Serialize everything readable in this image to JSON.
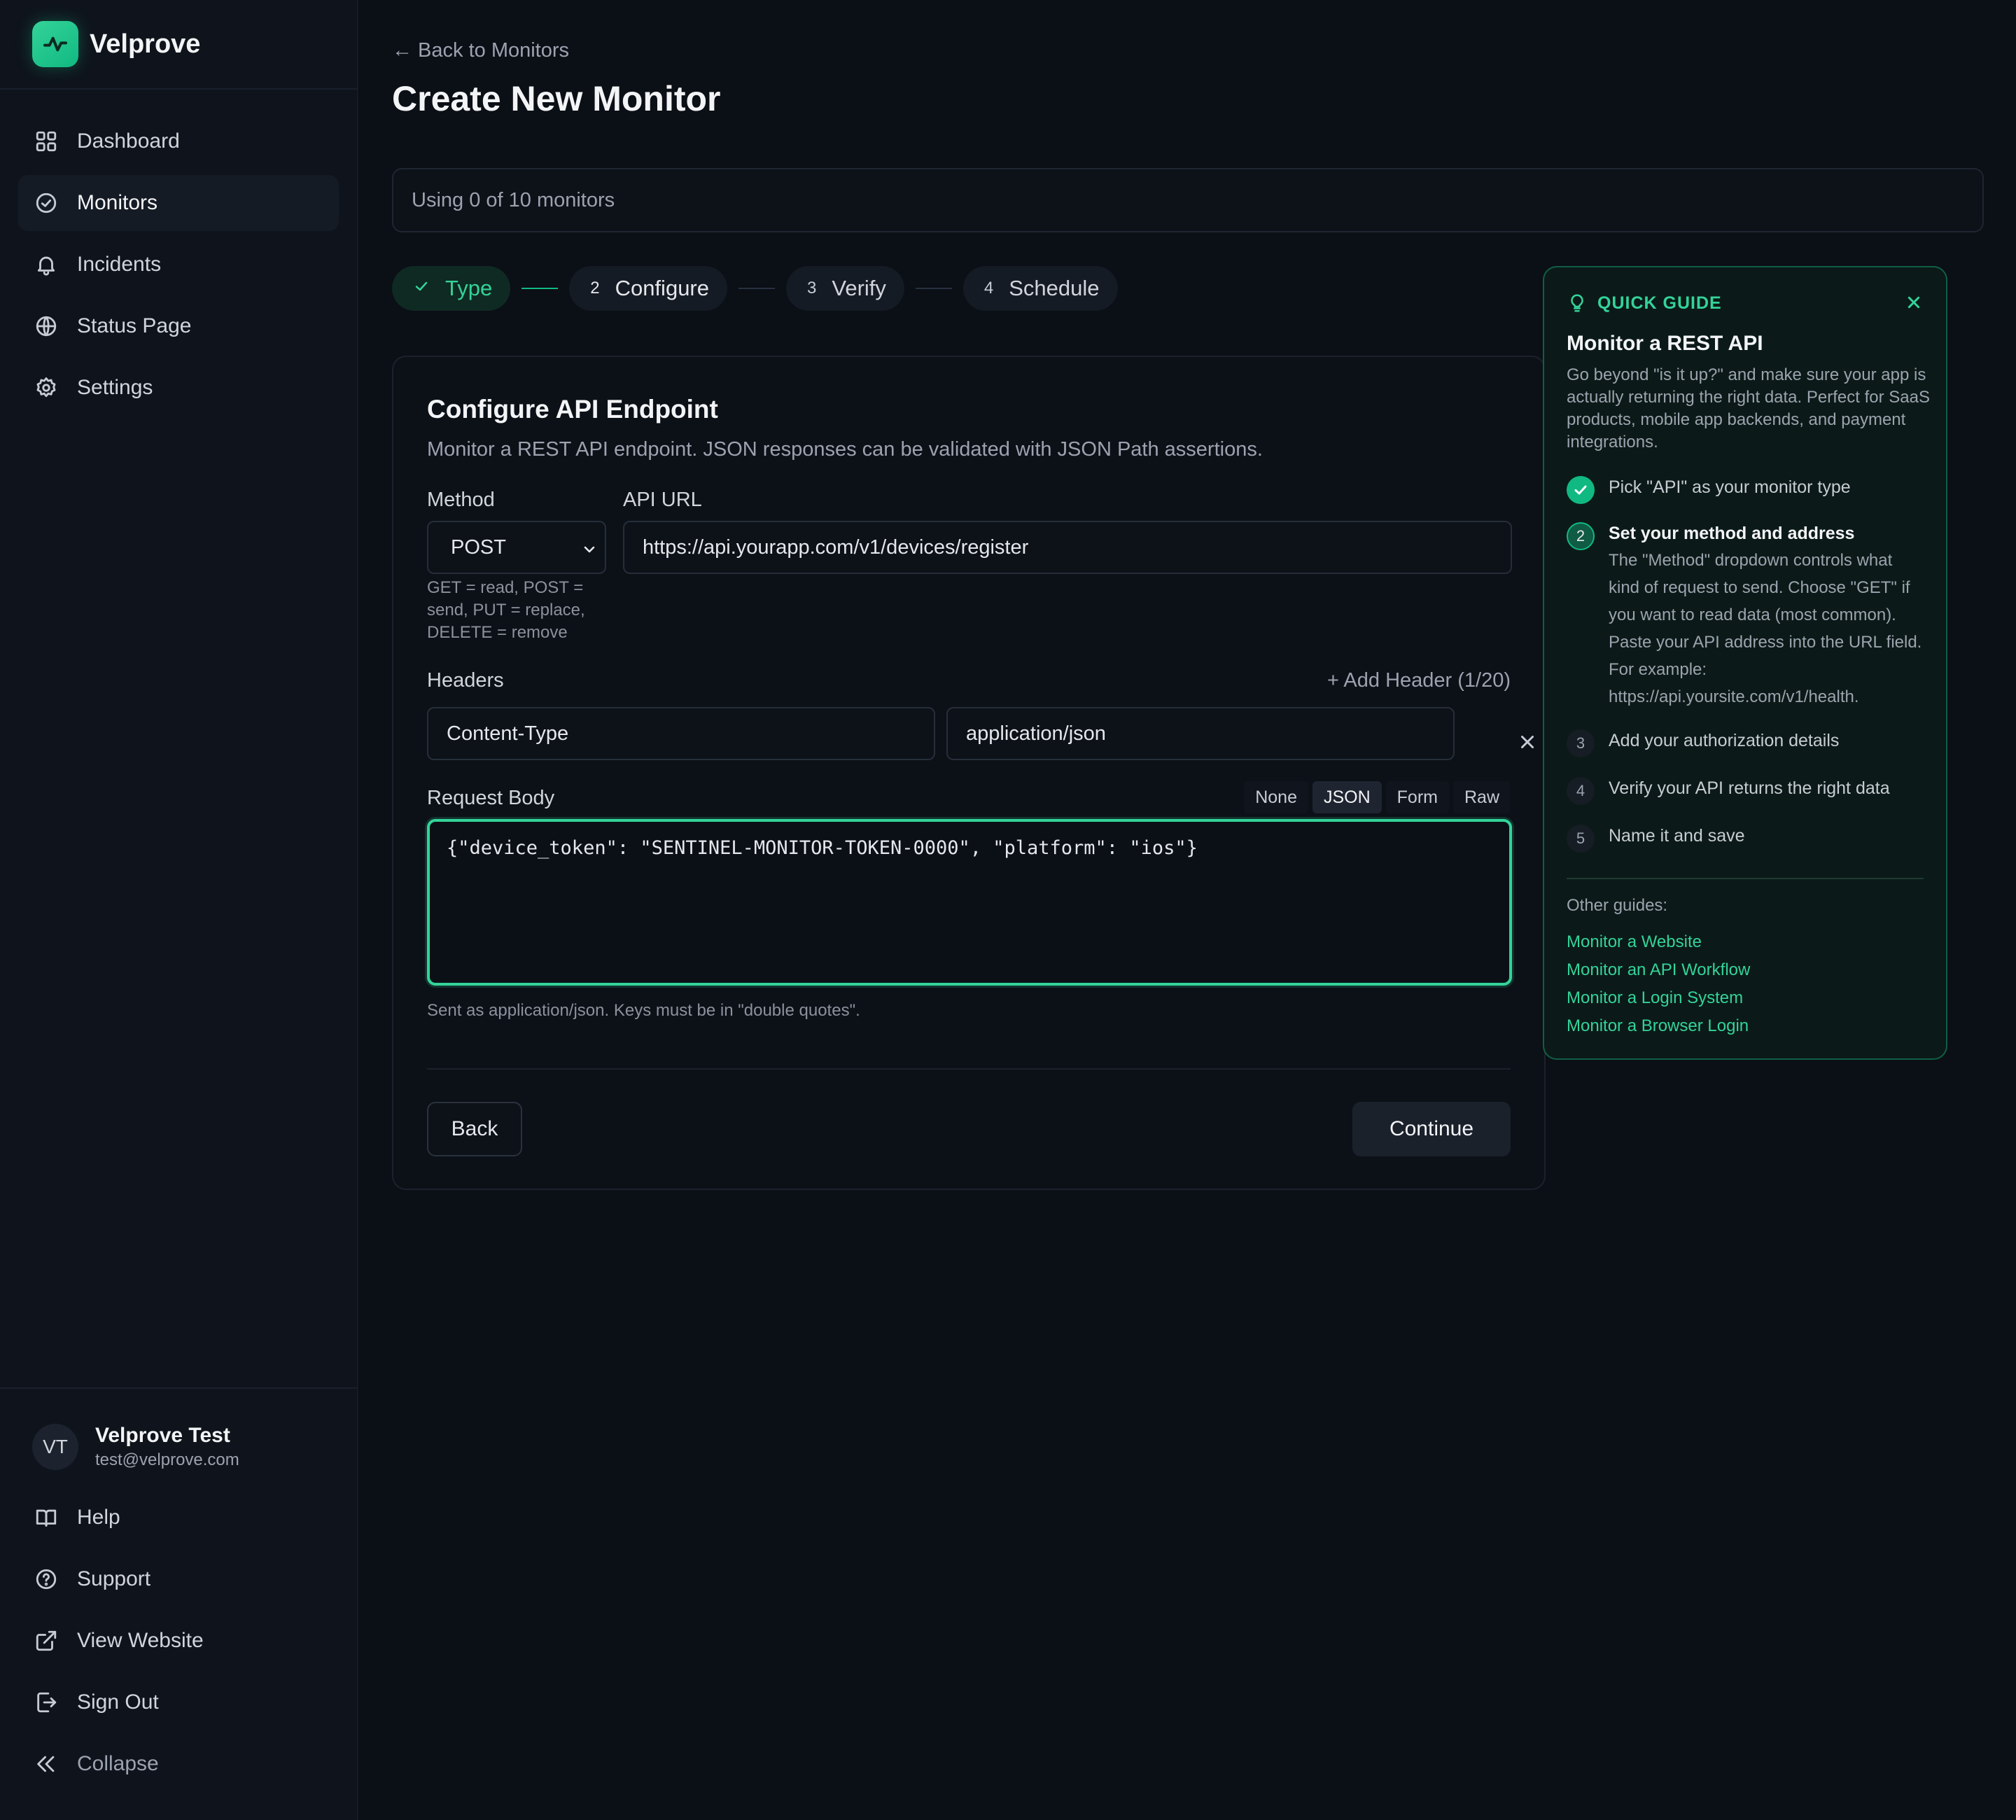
{
  "brand": {
    "name": "Velprove"
  },
  "nav": [
    {
      "label": "Dashboard",
      "icon": "grid-icon"
    },
    {
      "label": "Monitors",
      "icon": "check-circle-icon"
    },
    {
      "label": "Incidents",
      "icon": "bell-icon"
    },
    {
      "label": "Status Page",
      "icon": "globe-icon"
    },
    {
      "label": "Settings",
      "icon": "gear-icon"
    }
  ],
  "user": {
    "initials": "VT",
    "name": "Velprove Test",
    "email": "test@velprove.com"
  },
  "bottom_nav": [
    {
      "label": "Help",
      "icon": "book-icon"
    },
    {
      "label": "Support",
      "icon": "question-circle-icon"
    },
    {
      "label": "View Website",
      "icon": "external-link-icon"
    },
    {
      "label": "Sign Out",
      "icon": "sign-out-icon"
    },
    {
      "label": "Collapse",
      "icon": "double-chevron-left-icon"
    }
  ],
  "page": {
    "back_link": "← Back to Monitors",
    "title": "Create New Monitor",
    "usage": "Using 0 of 10 monitors"
  },
  "stepper": [
    {
      "num": "✓",
      "label": "Type",
      "state": "done"
    },
    {
      "num": "2",
      "label": "Configure",
      "state": "current"
    },
    {
      "num": "3",
      "label": "Verify",
      "state": "pending"
    },
    {
      "num": "4",
      "label": "Schedule",
      "state": "pending"
    }
  ],
  "form": {
    "title": "Configure API Endpoint",
    "subtitle": "Monitor a REST API endpoint. JSON responses can be validated with JSON Path assertions.",
    "method_label": "Method",
    "method_value": "POST",
    "method_hint": [
      "GET = read, POST =",
      "send, PUT = replace,",
      "DELETE = remove"
    ],
    "url_label": "API URL",
    "url_value": "https://api.yourapp.com/v1/devices/register",
    "headers_label": "Headers",
    "add_header": "+ Add Header (1/20)",
    "header_key": "Content-Type",
    "header_value": "application/json",
    "body_label": "Request Body",
    "body_tabs": [
      "None",
      "JSON",
      "Form",
      "Raw"
    ],
    "body_active_tab": "JSON",
    "body_value": "{\"device_token\": \"SENTINEL-MONITOR-TOKEN-0000\", \"platform\": \"ios\"}",
    "body_hint": "Sent as application/json. Keys must be in \"double quotes\".",
    "back_button": "Back",
    "continue_button": "Continue"
  },
  "guide": {
    "heading": "QUICK GUIDE",
    "title": "Monitor a REST API",
    "description": "Go beyond \"is it up?\" and make sure your app is actually returning the right data. Perfect for SaaS products, mobile app backends, and payment integrations.",
    "steps": [
      {
        "num": "✓",
        "text": "Pick \"API\" as your monitor type",
        "state": "done"
      },
      {
        "num": "2",
        "text": "Set your method and address",
        "state": "current",
        "detail": "The \"Method\" dropdown controls what kind of request to send. Choose \"GET\" if you want to read data (most common). Paste your API address into the URL field. For example: https://api.yoursite.com/v1/health."
      },
      {
        "num": "3",
        "text": "Add your authorization details",
        "state": "pending"
      },
      {
        "num": "4",
        "text": "Verify your API returns the right data",
        "state": "pending"
      },
      {
        "num": "5",
        "text": "Name it and save",
        "state": "pending"
      }
    ],
    "other_label": "Other guides:",
    "other_links": [
      "Monitor a Website",
      "Monitor an API Workflow",
      "Monitor a Login System",
      "Monitor a Browser Login"
    ]
  },
  "colors": {
    "accent": "#34d399",
    "accent_dark": "#10b981",
    "background": "#0b0f16"
  }
}
